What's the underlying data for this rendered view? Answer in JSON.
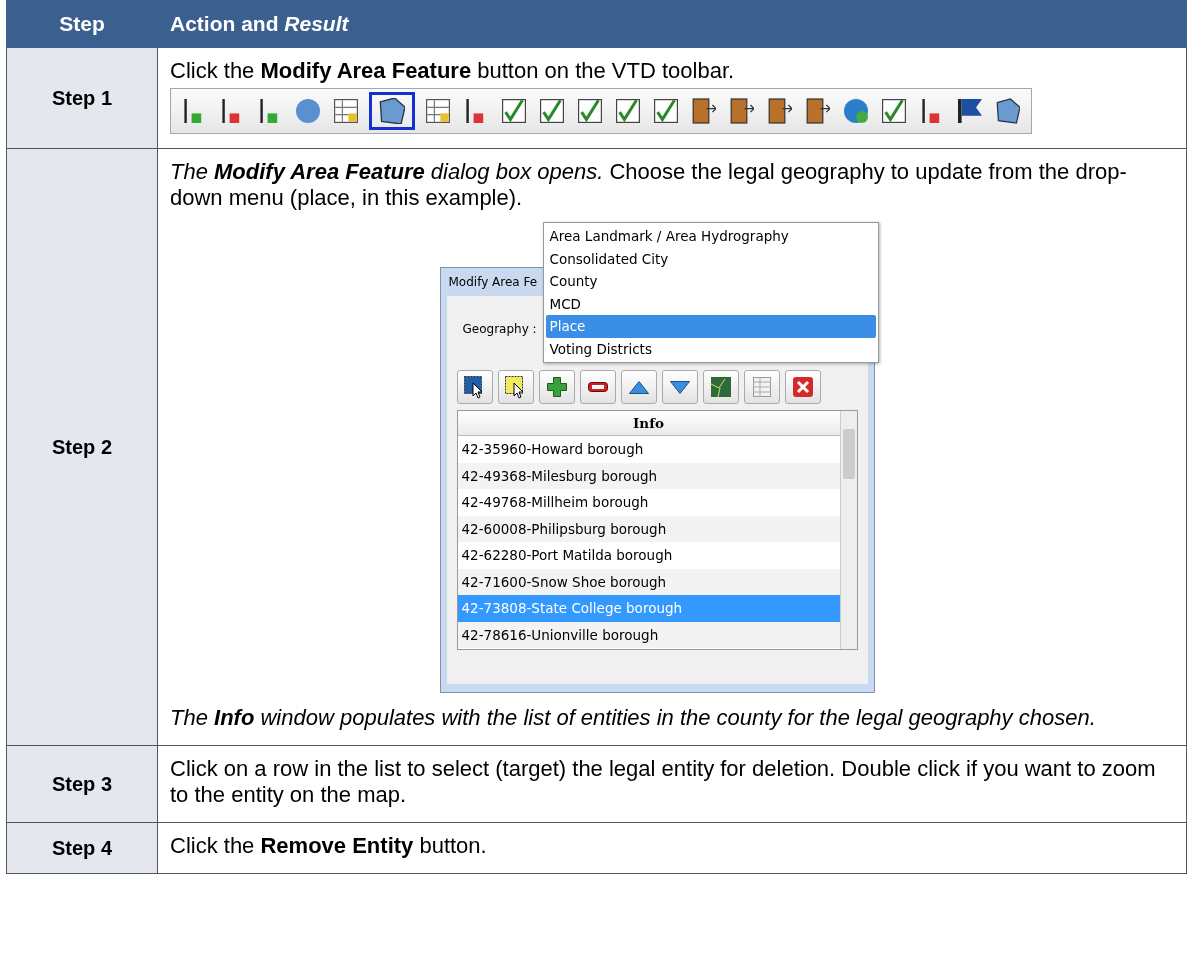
{
  "table": {
    "columns": [
      "Step",
      "Action and *Result*"
    ],
    "steps": [
      {
        "label": "Step 1",
        "text": "Click the **Modify Area Feature** button on the VTD toolbar.",
        "toolbar": {
          "tools": [
            {
              "selected": false
            },
            {
              "selected": false
            },
            {
              "selected": false
            },
            {
              "selected": false
            },
            {
              "selected": false
            },
            {
              "selected": true
            },
            {
              "selected": false
            },
            {
              "selected": false
            },
            {
              "selected": false
            },
            {
              "selected": false
            },
            {
              "selected": false
            },
            {
              "selected": false
            },
            {
              "selected": false
            },
            {
              "selected": false
            },
            {
              "selected": false
            },
            {
              "selected": false
            },
            {
              "selected": false
            },
            {
              "selected": false
            },
            {
              "selected": false
            },
            {
              "selected": false
            },
            {
              "selected": false
            },
            {
              "selected": false
            }
          ]
        }
      },
      {
        "label": "Step 2",
        "lead": "The **Modify Area Feature** dialog box opens.",
        "text": "Choose the legal geography to update from the drop-down menu (place, in this example).",
        "dialog": {
          "title": "Modify Area Fe",
          "geography_label": "Geography :",
          "dropdown_options": [
            {
              "label": "Area Landmark / Area Hydrography",
              "selected": false
            },
            {
              "label": "Consolidated City",
              "selected": false
            },
            {
              "label": "County",
              "selected": false
            },
            {
              "label": "MCD",
              "selected": false
            },
            {
              "label": "Place",
              "selected": true
            },
            {
              "label": "Voting Districts",
              "selected": false
            }
          ],
          "list_header": "Info",
          "rows": [
            {
              "label": "42-35960-Howard borough",
              "selected": false
            },
            {
              "label": "42-49368-Milesburg borough",
              "selected": false
            },
            {
              "label": "42-49768-Millheim borough",
              "selected": false
            },
            {
              "label": "42-60008-Philipsburg borough",
              "selected": false
            },
            {
              "label": "42-62280-Port Matilda borough",
              "selected": false
            },
            {
              "label": "42-71600-Snow Shoe borough",
              "selected": false
            },
            {
              "label": "42-73808-State College borough",
              "selected": true
            },
            {
              "label": "42-78616-Unionville borough",
              "selected": false
            }
          ]
        },
        "note": "The **Info** window populates with the list of entities in the county for the legal geography chosen."
      },
      {
        "label": "Step 3",
        "text": "Click on a row in the list to select (target) the legal entity for deletion. Double click if you want to zoom to the entity on the map."
      },
      {
        "label": "Step 4",
        "text": "Click the **Remove Entity** button."
      }
    ]
  }
}
